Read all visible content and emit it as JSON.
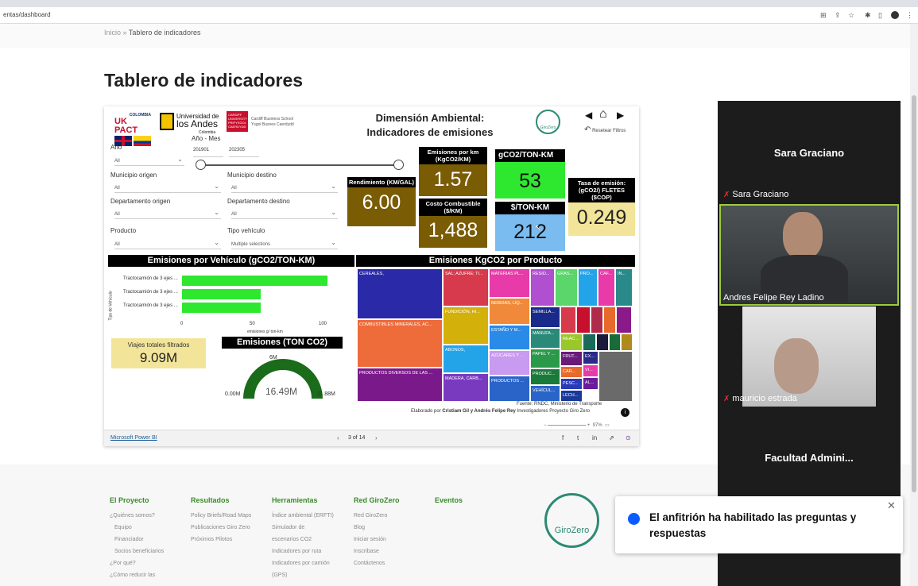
{
  "browser": {
    "url": "entas/dashboard"
  },
  "page": {
    "breadcrumb_home": "Inicio",
    "breadcrumb_sep": "»",
    "breadcrumb_current": "Tablero de indicadores",
    "title": "Tablero de indicadores"
  },
  "report": {
    "logo_ukpact_top": "COLOMBIA",
    "logo_ukpact": "UK PACT",
    "logo_uniandes_1": "Universidad de",
    "logo_uniandes_2": "los Andes",
    "logo_uniandes_3": "Colombia",
    "logo_cardiff_1": "Cardiff Business School",
    "logo_cardiff_2": "Ysgol Busnes Caerdydd",
    "title_1": "Dimensión Ambiental:",
    "title_2": "Indicadores de emisiones",
    "reset_label": "Resetear Filtros",
    "range_label": "Año - Mes",
    "range_start": "201901",
    "range_end": "202305",
    "filters": {
      "anio_label": "Año",
      "anio_value": "All",
      "mun_origen_label": "Municipio origen",
      "mun_origen_value": "All",
      "mun_destino_label": "Municipio destino",
      "mun_destino_value": "All",
      "dep_origen_label": "Departamento origen",
      "dep_origen_value": "All",
      "dep_destino_label": "Departamento destino",
      "dep_destino_value": "All",
      "producto_label": "Producto",
      "producto_value": "All",
      "tipo_label": "Tipo vehículo",
      "tipo_value": "Multiple selections"
    },
    "kpis": {
      "rendimiento_label": "Rendimiento (KM/GAL)",
      "rendimiento_value": "6.00",
      "emisiones_km_label": "Emisiones por km (KgCO2/KM)",
      "emisiones_km_value": "1.57",
      "costo_label": "Costo Combustible ($/KM)",
      "costo_value": "1,488",
      "gco2_label": "gCO2/TON-KM",
      "gco2_value": "53",
      "ton_km_label": "$/TON-KM",
      "ton_km_value": "212",
      "tasa_label": "Tasa de emisión: (gCO2/) FLETES ($COP)",
      "tasa_value": "0.249"
    },
    "veh_title": "Emisiones por Vehículo (gCO2/TON-KM)",
    "veh_axis_y": "Tipo de Vehículo",
    "veh_axis_x": "emisiones g/ ton-km",
    "veh_ticks": [
      "0",
      "50",
      "100"
    ],
    "veh_bars": [
      {
        "label": "Tractocamión de 3 ejes ...",
        "value": 105
      },
      {
        "label": "Tractocamión de 3 ejes ...",
        "value": 57
      },
      {
        "label": "Tractocamión de 3 ejes ...",
        "value": 57
      }
    ],
    "viajes_label": "Viajes totales filtrados",
    "viajes_value": "9.09M",
    "gauge_title": "Emisiones (TON CO2)",
    "gauge_min": "0.00M",
    "gauge_max": "11.88M",
    "gauge_target": "6M",
    "gauge_value": "16.49M",
    "prod_title": "Emisiones KgCO2 por Producto",
    "treemap": [
      "CEREALES,",
      "COMBUSTIBLES MINERALES, AC...",
      "PRODUCTOS DIVERSOS DE LAS ...",
      "SAL; AZUFRE; TI...",
      "FUNDICIÓN, HI...",
      "ABONOS,",
      "MADERA, CARB...",
      "MATERIAS PL...",
      "BEBIDAS, LÍQ...",
      "ESTAÑO Y M...",
      "AZÚCARES Y ...",
      "PRODUCTOS ...",
      "RESID...",
      "GRAS...",
      "PRO...",
      "CAF...",
      "IN...",
      "SEMILLA...",
      "MANUFA...",
      "PAPEL Y ...",
      "PRODUC...",
      "VEHÍCUL...",
      "REAC...",
      "FRUT...",
      "CAR...",
      "PESC...",
      "LECH...",
      "EX...",
      "VI...",
      "AL..."
    ],
    "source_line": "Fuente: RNDC, Ministerio de Transporte",
    "credit_prefix": "Elaborado por",
    "credit_names": "Cristiam Gil y Andrés Felipe Rey",
    "credit_suffix": "Investigadores Proyecto Giro Zero",
    "zoom_pct": "97%",
    "powerbi_link": "Microsoft Power BI",
    "page_indicator": "3 of 14"
  },
  "footer": {
    "col1_title": "El Proyecto",
    "col1": [
      "¿Quiénes somos?",
      "Equipo",
      "Financiador",
      "Socios beneficiarios",
      "¿Por qué?",
      "¿Cómo reducir las"
    ],
    "col2_title": "Resultados",
    "col2": [
      "Policy Briefs/Road Maps",
      "Publicaciones Giro Zero",
      "Próximos Pilotos"
    ],
    "col3_title": "Herramientas",
    "col3": [
      "Índice ambiental (ERFTI)",
      "Simulador de",
      "escenarios CO2",
      "Indicadores por ruta",
      "Indicadores por camión",
      "(GPS)"
    ],
    "col4_title": "Red GiroZero",
    "col4": [
      "Red GiroZero",
      "Blog",
      "Iniciar sesión",
      "Inscribase",
      "Contáctenos"
    ],
    "col5_title": "Eventos",
    "logo_text": "GiroZero"
  },
  "zoom": {
    "presenter_big": "Sara Graciano",
    "presenter_small": "Sara Graciano",
    "p1_name": "Andres Felipe Rey Ladino",
    "p2_name": "mauricio estrada",
    "faculty": "Facultad  Admini..."
  },
  "toast": {
    "message": "El anfitrión ha habilitado las preguntas y respuestas"
  },
  "colors": {
    "kpi_olive": "#7a5c05",
    "kpi_green": "#2ee830",
    "kpi_blue": "#7bbcf0",
    "kpi_sand": "#f2e59a",
    "footer_green": "#3a8a2a"
  }
}
